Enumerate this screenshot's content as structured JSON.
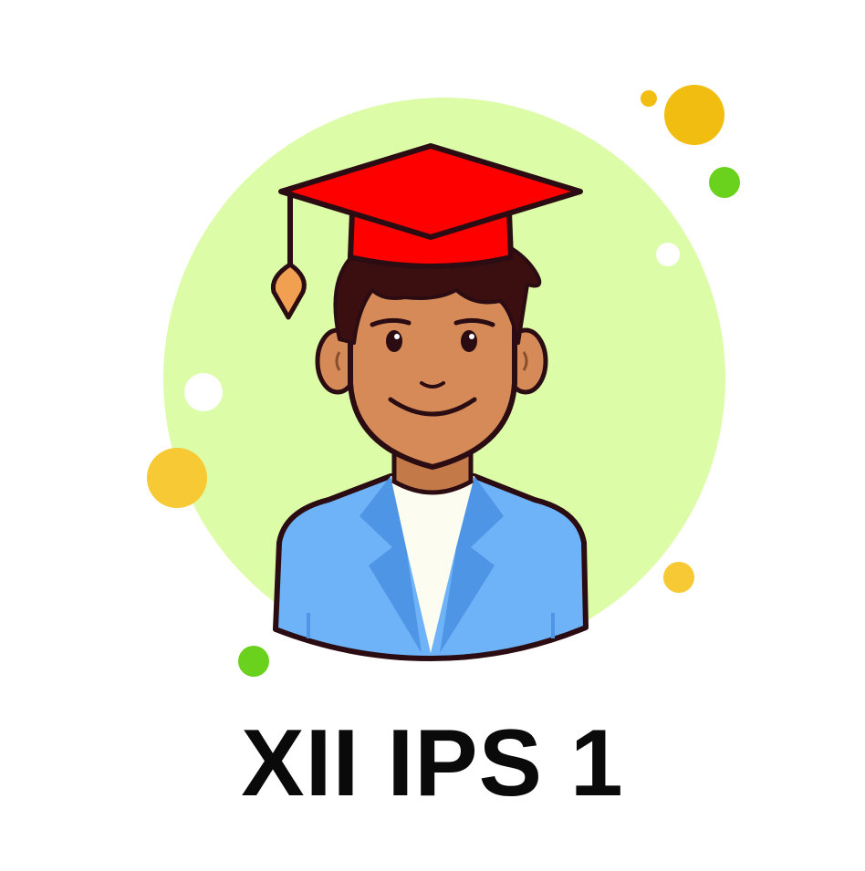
{
  "caption": {
    "text": "XII IPS 1"
  },
  "illustration": {
    "subject": "graduate-student-avatar",
    "colors": {
      "background_circle": "#dcfca8",
      "cap": "#ff0000",
      "tassel": "#f0a050",
      "skin": "#d58a57",
      "hair": "#3b0e10",
      "jacket": "#6eb3f7",
      "jacket_shadow": "#4f95e6",
      "shirt": "#fcfdf0",
      "outline": "#2a0c12",
      "dot_yellow": "#f5c12a",
      "dot_green": "#6ad11c",
      "dot_white": "#ffffff"
    }
  }
}
